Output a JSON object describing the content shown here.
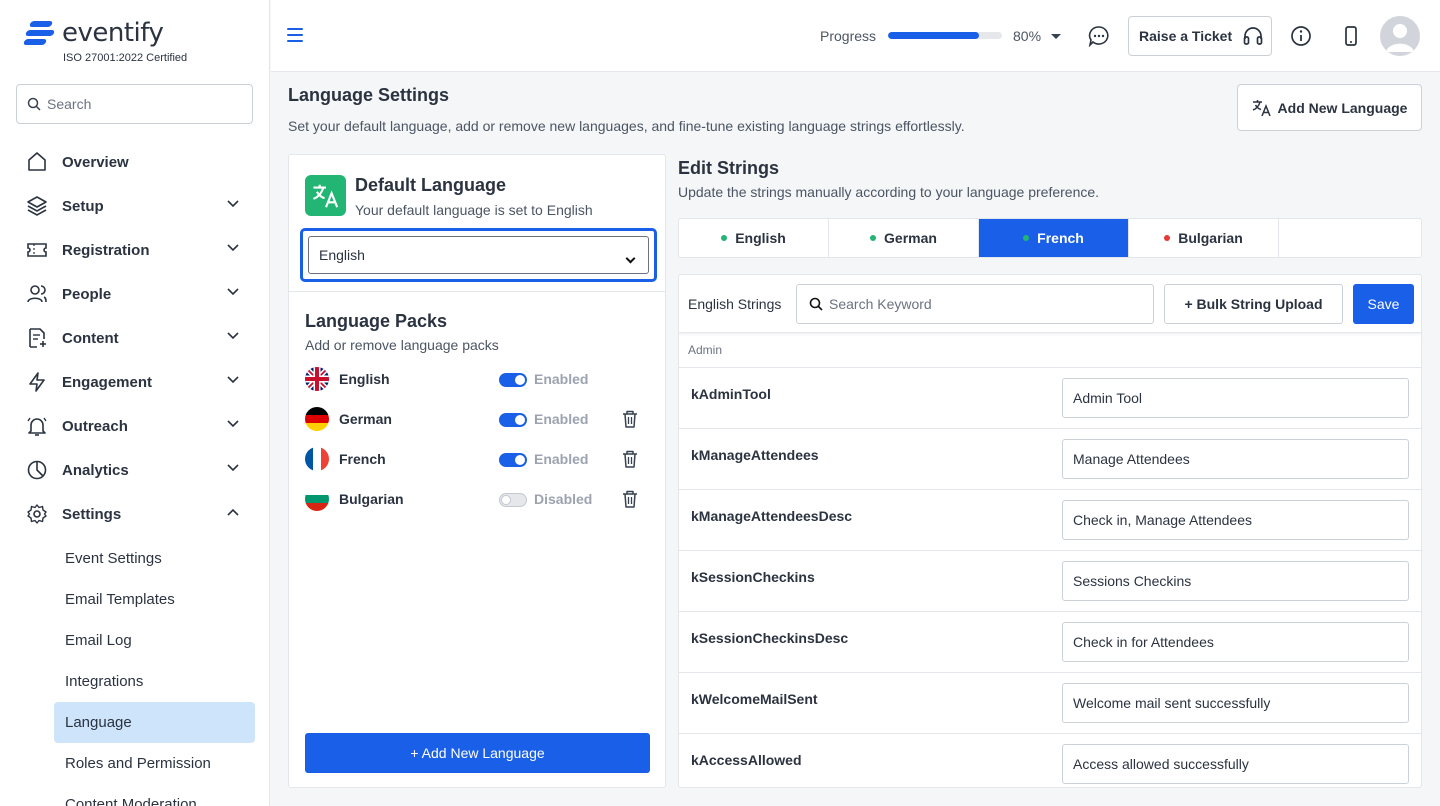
{
  "brand": {
    "name": "eventify",
    "certification": "ISO 27001:2022 Certified",
    "accent": "#1a5fe8"
  },
  "sidebar": {
    "search_placeholder": "Search",
    "items": [
      {
        "label": "Overview",
        "icon": "home-icon",
        "expandable": false
      },
      {
        "label": "Setup",
        "icon": "layers-icon",
        "expandable": true
      },
      {
        "label": "Registration",
        "icon": "ticket-icon",
        "expandable": true
      },
      {
        "label": "People",
        "icon": "users-icon",
        "expandable": true
      },
      {
        "label": "Content",
        "icon": "file-plus-icon",
        "expandable": true
      },
      {
        "label": "Engagement",
        "icon": "lightning-icon",
        "expandable": true
      },
      {
        "label": "Outreach",
        "icon": "bell-icon",
        "expandable": true
      },
      {
        "label": "Analytics",
        "icon": "pie-chart-icon",
        "expandable": true
      },
      {
        "label": "Settings",
        "icon": "gear-icon",
        "expandable": true,
        "expanded": true
      }
    ],
    "settings_sub": [
      "Event Settings",
      "Email Templates",
      "Email Log",
      "Integrations",
      "Language",
      "Roles and Permission",
      "Content Moderation"
    ],
    "active_sub": "Language"
  },
  "topbar": {
    "progress_label": "Progress",
    "progress_value": 80,
    "progress_text": "80%",
    "ticket_label": "Raise a Ticket"
  },
  "page": {
    "title": "Language Settings",
    "description": "Set your default language, add or remove new languages, and fine-tune existing language strings effortlessly.",
    "add_language_label": "Add New Language"
  },
  "default_language": {
    "title": "Default Language",
    "subtitle": "Your default language is set to English",
    "selected": "English"
  },
  "language_packs": {
    "title": "Language Packs",
    "subtitle": "Add or remove language packs",
    "packs": [
      {
        "name": "English",
        "status": "Enabled",
        "enabled": true,
        "deletable": false
      },
      {
        "name": "German",
        "status": "Enabled",
        "enabled": true,
        "deletable": true
      },
      {
        "name": "French",
        "status": "Enabled",
        "enabled": true,
        "deletable": true
      },
      {
        "name": "Bulgarian",
        "status": "Disabled",
        "enabled": false,
        "deletable": true
      }
    ],
    "add_button": "+ Add New Language"
  },
  "edit_strings": {
    "title": "Edit Strings",
    "subtitle": "Update the strings manually according to your language preference.",
    "tabs": [
      {
        "label": "English",
        "dot": "#22b573",
        "active": false
      },
      {
        "label": "German",
        "dot": "#22b573",
        "active": false
      },
      {
        "label": "French",
        "dot": "#22b573",
        "active": true
      },
      {
        "label": "Bulgarian",
        "dot": "#e53935",
        "active": false
      }
    ],
    "strings_label": "English Strings",
    "search_placeholder": "Search Keyword",
    "bulk_label": "+ Bulk String Upload",
    "save_label": "Save",
    "section": "Admin",
    "rows": [
      {
        "key": "kAdminTool",
        "value": "Admin Tool"
      },
      {
        "key": "kManageAttendees",
        "value": "Manage Attendees"
      },
      {
        "key": "kManageAttendeesDesc",
        "value": "Check in, Manage Attendees"
      },
      {
        "key": "kSessionCheckins",
        "value": "Sessions Checkins"
      },
      {
        "key": "kSessionCheckinsDesc",
        "value": "Check in for Attendees"
      },
      {
        "key": "kWelcomeMailSent",
        "value": "Welcome mail sent successfully"
      },
      {
        "key": "kAccessAllowed",
        "value": "Access allowed successfully"
      }
    ]
  }
}
